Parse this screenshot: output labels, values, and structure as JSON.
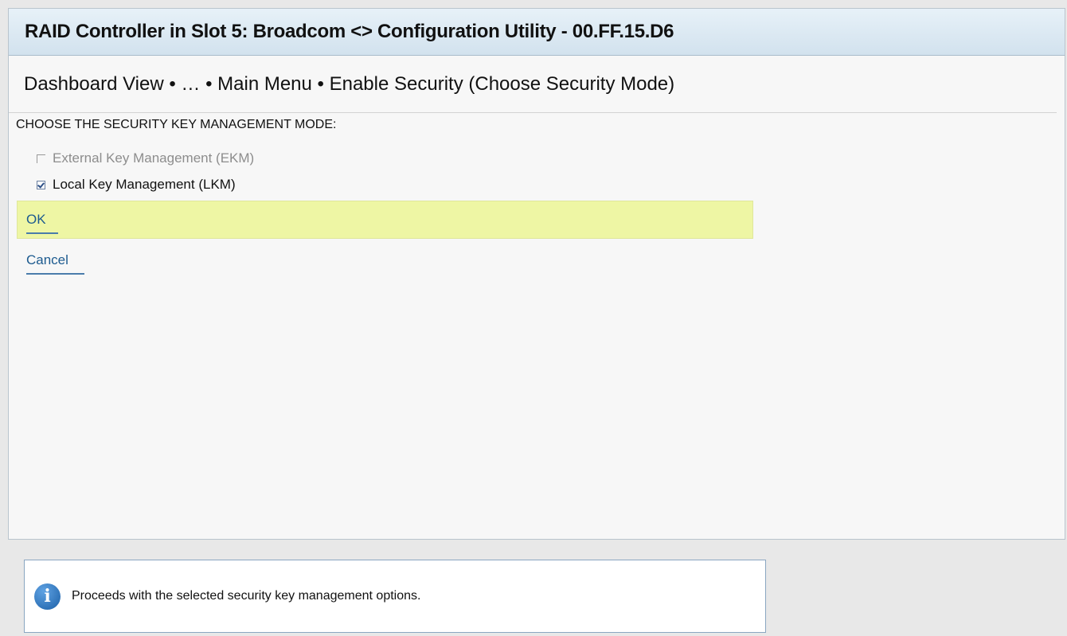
{
  "window": {
    "title": "RAID Controller in Slot 5: Broadcom <> Configuration Utility - 00.FF.15.D6"
  },
  "breadcrumb": {
    "text": "Dashboard View • … • Main Menu • Enable Security (Choose Security Mode)"
  },
  "form": {
    "heading": "CHOOSE THE SECURITY KEY MANAGEMENT MODE:",
    "options": [
      {
        "label": "External Key Management (EKM)",
        "checked": false,
        "enabled": false
      },
      {
        "label": "Local Key Management (LKM)",
        "checked": true,
        "enabled": true
      }
    ],
    "ok_label": "OK",
    "cancel_label": "Cancel"
  },
  "help": {
    "icon": "info-icon",
    "icon_glyph": "i",
    "text": "Proceeds with the selected security key management options."
  },
  "colors": {
    "highlight": "#eef6a4",
    "link": "#1d5b8f",
    "title_bar": "#d2e2ee"
  }
}
